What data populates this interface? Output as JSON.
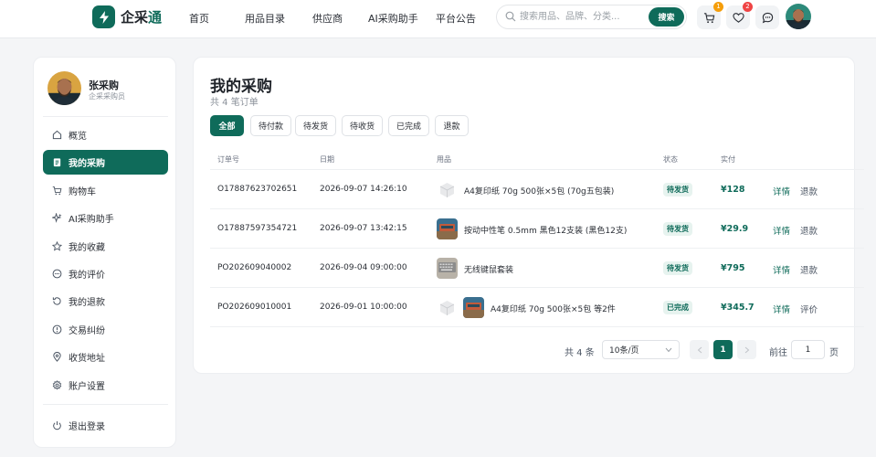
{
  "brand": {
    "name_part1": "企采",
    "name_part2": "通"
  },
  "nav": [
    "首页",
    "用品目录",
    "供应商",
    "AI采购助手",
    "平台公告"
  ],
  "search": {
    "placeholder": "搜索用品、品牌、分类...",
    "button": "搜索"
  },
  "header_icons": {
    "cart_badge": "1",
    "favorites_badge": "2"
  },
  "user": {
    "name": "张采购",
    "role": "企采采购员"
  },
  "menu": [
    {
      "label": "概览",
      "icon": "home-icon"
    },
    {
      "label": "我的采购",
      "icon": "clipboard-icon",
      "active": true
    },
    {
      "label": "购物车",
      "icon": "cart-icon"
    },
    {
      "label": "AI采购助手",
      "icon": "sparkle-icon"
    },
    {
      "label": "我的收藏",
      "icon": "star-icon"
    },
    {
      "label": "我的评价",
      "icon": "comment-icon"
    },
    {
      "label": "我的退款",
      "icon": "refund-icon"
    },
    {
      "label": "交易纠纷",
      "icon": "alert-icon"
    },
    {
      "label": "收货地址",
      "icon": "location-icon"
    },
    {
      "label": "账户设置",
      "icon": "gear-icon"
    }
  ],
  "logout": "退出登录",
  "page": {
    "title": "我的采购",
    "subtitle": "共 4 笔订单"
  },
  "tabs": [
    "全部",
    "待付款",
    "待发货",
    "待收货",
    "已完成",
    "退款"
  ],
  "columns": {
    "order_no": "订单号",
    "date": "日期",
    "item": "用品",
    "status": "状态",
    "paid": "实付"
  },
  "orders": [
    {
      "order_no": "O17887623702651",
      "date": "2026-09-07 14:26:10",
      "item": "A4复印纸 70g 500张×5包 (70g五包装)",
      "status": "待发货",
      "paid": "¥128",
      "action1": "详情",
      "action2": "退款"
    },
    {
      "order_no": "O17887597354721",
      "date": "2026-09-07 13:42:15",
      "item": "按动中性笔 0.5mm 黑色12支装 (黑色12支)",
      "status": "待发货",
      "paid": "¥29.9",
      "action1": "详情",
      "action2": "退款"
    },
    {
      "order_no": "PO202609040002",
      "date": "2026-09-04 09:00:00",
      "item": "无线键鼠套装",
      "status": "待发货",
      "paid": "¥795",
      "action1": "详情",
      "action2": "退款"
    },
    {
      "order_no": "PO202609010001",
      "date": "2026-09-01 10:00:00",
      "item": "A4复印纸 70g 500张×5包 等2件",
      "status": "已完成",
      "paid": "¥345.7",
      "action1": "详情",
      "action2": "评价"
    }
  ],
  "pagination": {
    "total": "共 4 条",
    "page_size": "10条/页",
    "current": "1",
    "goto_label": "前往",
    "goto_value": "1",
    "page_suffix": "页"
  },
  "colors": {
    "primary": "#0f6b5a",
    "badge_orange": "#f59e0b",
    "badge_red": "#ef4444",
    "status_bg": "#e7f3ef"
  }
}
